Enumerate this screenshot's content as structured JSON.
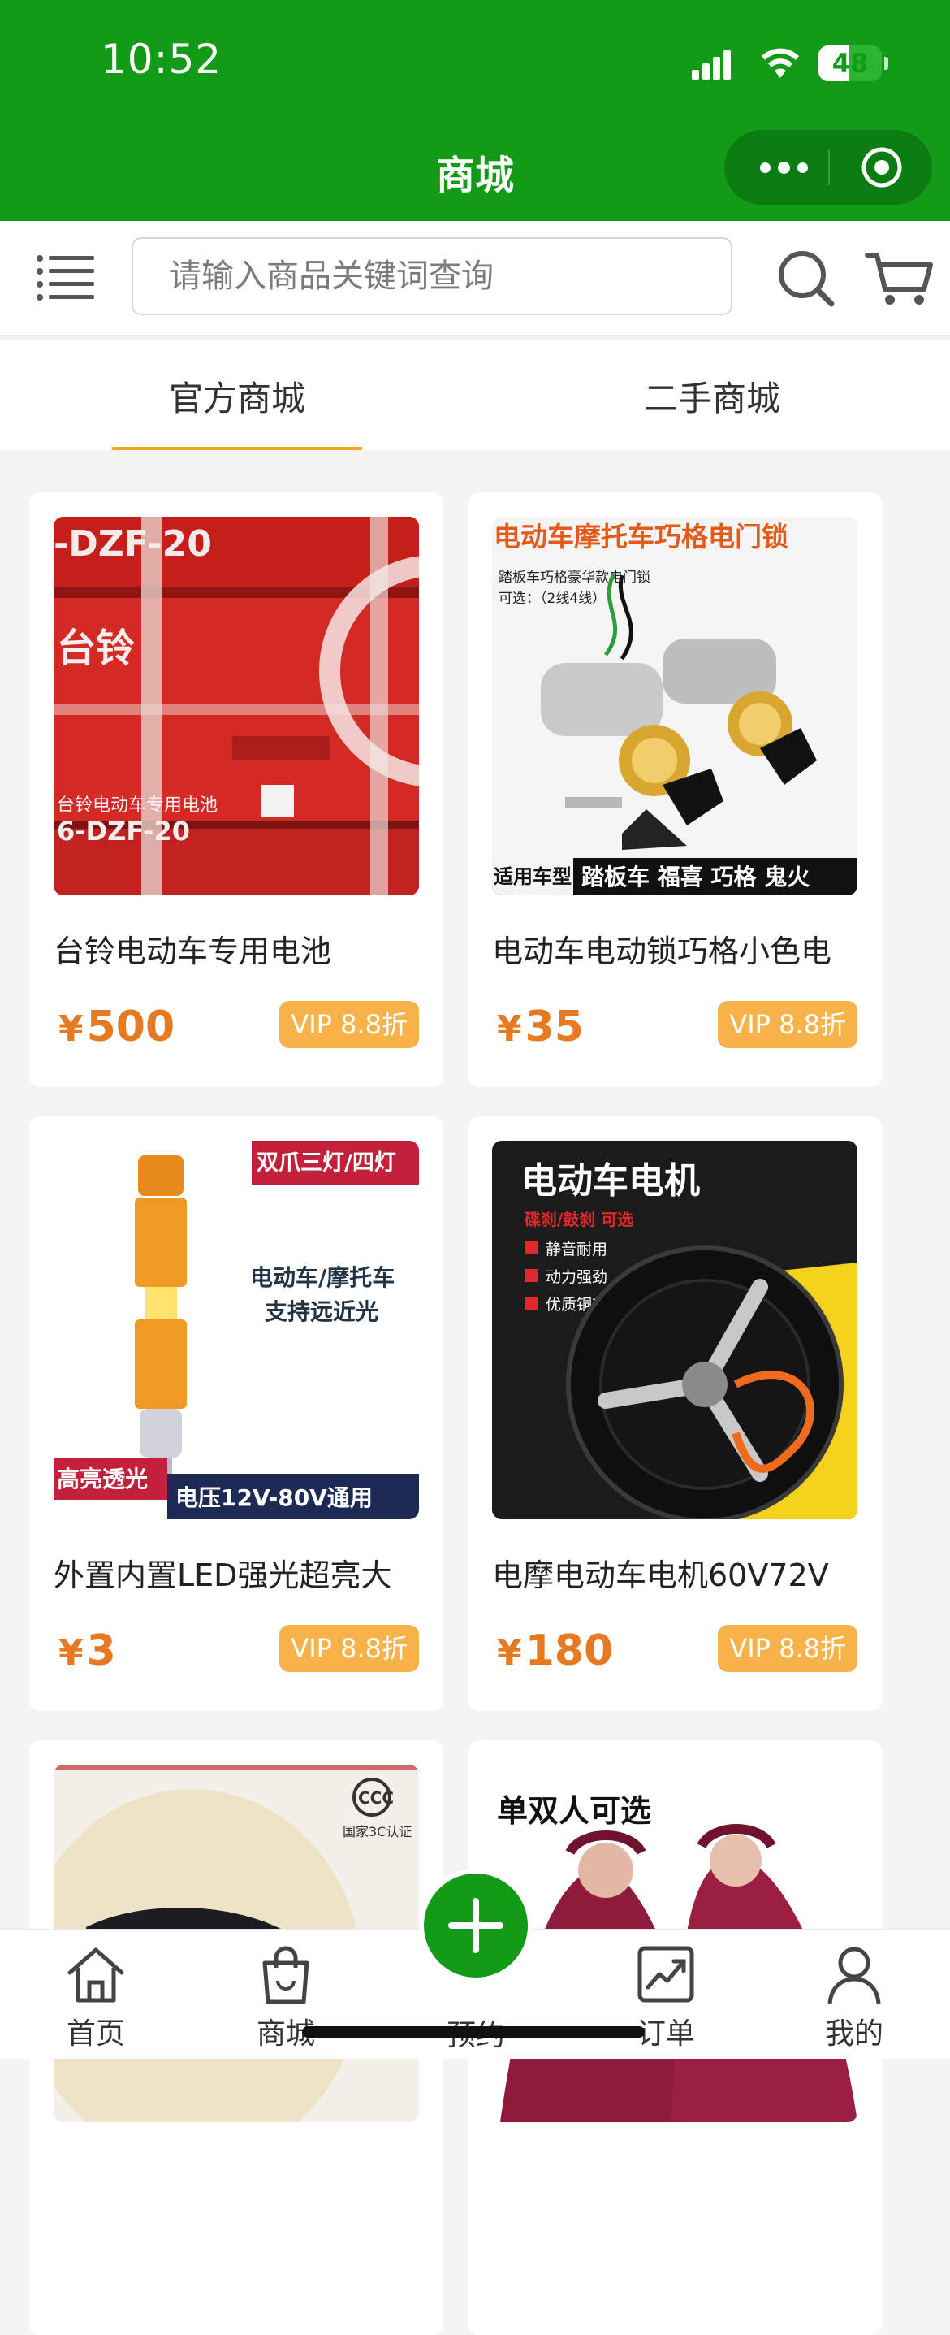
{
  "status_bar": {
    "time": "10:52",
    "battery": "48"
  },
  "header": {
    "title": "商城"
  },
  "search": {
    "placeholder": "请输入商品关键词查询"
  },
  "tabs": [
    {
      "label": "官方商城",
      "active": true
    },
    {
      "label": "二手商城",
      "active": false
    }
  ],
  "products": [
    {
      "name": "台铃电动车专用电池",
      "price": "500",
      "currency": "¥",
      "badge": "VIP 8.8折",
      "image_text": [
        "-DZF-20",
        "台铃",
        "台铃电动车专用电池",
        "6-DZF-20"
      ]
    },
    {
      "name": "电动车电动锁巧格小色电",
      "price": "35",
      "currency": "¥",
      "badge": "VIP 8.8折",
      "image_text": [
        "电动车摩托车巧格电门锁",
        "踏板车巧格豪华款电门锁",
        "可选：（2线4线）",
        "适用车型",
        "踏板车 福喜 巧格 鬼火"
      ]
    },
    {
      "name": "外置内置LED强光超亮大",
      "price": "3",
      "currency": "¥",
      "badge": "VIP 8.8折",
      "image_text": [
        "双爪三灯/四灯",
        "电动车/摩托车",
        "支持远近光",
        "高亮透光",
        "电压12V-80V通用"
      ]
    },
    {
      "name": "电摩电动车电机60V72V",
      "price": "180",
      "currency": "¥",
      "badge": "VIP 8.8折",
      "image_text": [
        "电动车电机",
        "碟刹/鼓刹 可选",
        "静音耐用",
        "动力强劲",
        "优质铜芯"
      ]
    },
    {
      "name": "",
      "image_text": [
        "国家3C认证"
      ]
    },
    {
      "name": "",
      "image_text": [
        "单双人可选"
      ]
    }
  ],
  "tabbar": [
    {
      "label": "首页",
      "icon": "home-icon"
    },
    {
      "label": "商城",
      "icon": "shopping-bag-icon"
    },
    {
      "label": "预约",
      "icon": "plus-icon"
    },
    {
      "label": "订单",
      "icon": "chart-icon"
    },
    {
      "label": "我的",
      "icon": "user-icon"
    }
  ],
  "colors": {
    "brand_green": "#139b18",
    "accent_orange": "#e57a22",
    "vip_badge": "#f7b24a",
    "tab_underline": "#f2a424"
  }
}
